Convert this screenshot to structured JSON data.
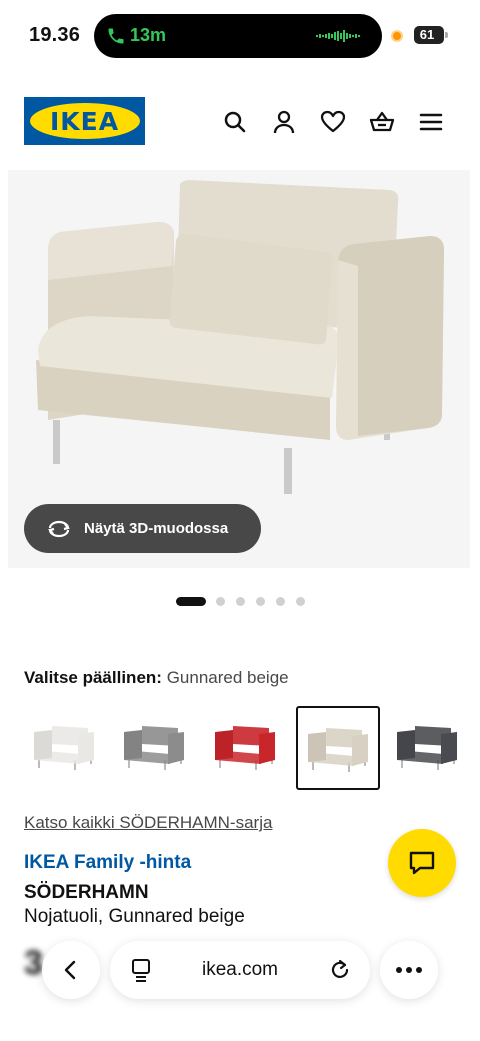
{
  "status_bar": {
    "time": "19.36",
    "call_duration": "13m",
    "battery": "61"
  },
  "header": {
    "logo_text": "IKEA",
    "icons": [
      "search-icon",
      "account-icon",
      "heart-icon",
      "basket-icon",
      "menu-icon"
    ]
  },
  "product_image": {
    "view_3d_label": "Näytä 3D-muodossa",
    "carousel_total": 6,
    "carousel_active": 1
  },
  "variants": {
    "heading_label": "Valitse päällinen:",
    "selected_value": "Gunnared beige",
    "options": [
      {
        "color": "#e9e8e5",
        "selected": false
      },
      {
        "color": "#8c8c8c",
        "selected": false
      },
      {
        "color": "#c8262b",
        "selected": false
      },
      {
        "color": "#d8d1c3",
        "selected": true
      },
      {
        "color": "#4a4b50",
        "selected": false
      }
    ]
  },
  "info": {
    "series_link": "Katso kaikki SÖDERHAMN-sarja",
    "family_price_label": "IKEA Family -hinta",
    "product_name": "SÖDERHAMN",
    "product_desc": "Nojatuoli, Gunnared beige",
    "price_partial": "3"
  },
  "browser": {
    "url": "ikea.com"
  },
  "colors": {
    "ikea_blue": "#0058a3",
    "ikea_yellow": "#ffdb00",
    "call_green": "#34c759"
  }
}
